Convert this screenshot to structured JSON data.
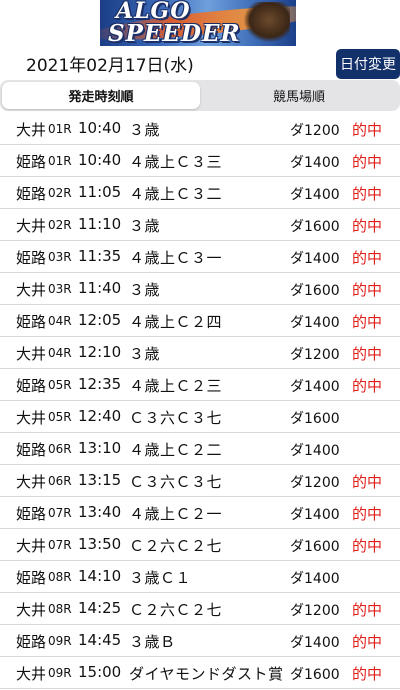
{
  "banner": {
    "logo_top": "ALGO",
    "logo_bottom": "SPEEDER"
  },
  "header": {
    "date": "2021年02月17日(水)",
    "date_change_label": "日付変更"
  },
  "tabs": [
    {
      "label": "発走時刻順",
      "active": true
    },
    {
      "label": "競馬場順",
      "active": false
    }
  ],
  "colors": {
    "accent": "#12306a",
    "hit": "#e0221b"
  },
  "races": [
    {
      "venue": "大井",
      "round": "01R",
      "time": "10:40",
      "name": "３歳",
      "course": "ダ1200",
      "result": "的中"
    },
    {
      "venue": "姫路",
      "round": "01R",
      "time": "10:40",
      "name": "４歳上Ｃ３三",
      "course": "ダ1400",
      "result": "的中"
    },
    {
      "venue": "姫路",
      "round": "02R",
      "time": "11:05",
      "name": "４歳上Ｃ３二",
      "course": "ダ1400",
      "result": "的中"
    },
    {
      "venue": "大井",
      "round": "02R",
      "time": "11:10",
      "name": "３歳",
      "course": "ダ1600",
      "result": "的中"
    },
    {
      "venue": "姫路",
      "round": "03R",
      "time": "11:35",
      "name": "４歳上Ｃ３一",
      "course": "ダ1400",
      "result": "的中"
    },
    {
      "venue": "大井",
      "round": "03R",
      "time": "11:40",
      "name": "３歳",
      "course": "ダ1600",
      "result": "的中"
    },
    {
      "venue": "姫路",
      "round": "04R",
      "time": "12:05",
      "name": "４歳上Ｃ２四",
      "course": "ダ1400",
      "result": "的中"
    },
    {
      "venue": "大井",
      "round": "04R",
      "time": "12:10",
      "name": "３歳",
      "course": "ダ1200",
      "result": "的中"
    },
    {
      "venue": "姫路",
      "round": "05R",
      "time": "12:35",
      "name": "４歳上Ｃ２三",
      "course": "ダ1400",
      "result": "的中"
    },
    {
      "venue": "大井",
      "round": "05R",
      "time": "12:40",
      "name": "Ｃ３六Ｃ３七",
      "course": "ダ1600",
      "result": ""
    },
    {
      "venue": "姫路",
      "round": "06R",
      "time": "13:10",
      "name": "４歳上Ｃ２二",
      "course": "ダ1400",
      "result": ""
    },
    {
      "venue": "大井",
      "round": "06R",
      "time": "13:15",
      "name": "Ｃ３六Ｃ３七",
      "course": "ダ1200",
      "result": "的中"
    },
    {
      "venue": "姫路",
      "round": "07R",
      "time": "13:40",
      "name": "４歳上Ｃ２一",
      "course": "ダ1400",
      "result": "的中"
    },
    {
      "venue": "大井",
      "round": "07R",
      "time": "13:50",
      "name": "Ｃ２六Ｃ２七",
      "course": "ダ1600",
      "result": "的中"
    },
    {
      "venue": "姫路",
      "round": "08R",
      "time": "14:10",
      "name": "３歳Ｃ１",
      "course": "ダ1400",
      "result": ""
    },
    {
      "venue": "大井",
      "round": "08R",
      "time": "14:25",
      "name": "Ｃ２六Ｃ２七",
      "course": "ダ1200",
      "result": "的中"
    },
    {
      "venue": "姫路",
      "round": "09R",
      "time": "14:45",
      "name": "３歳Ｂ",
      "course": "ダ1400",
      "result": "的中"
    },
    {
      "venue": "大井",
      "round": "09R",
      "time": "15:00",
      "name": "ダイヤモンドダスト賞",
      "course": "ダ1600",
      "result": "的中"
    }
  ]
}
